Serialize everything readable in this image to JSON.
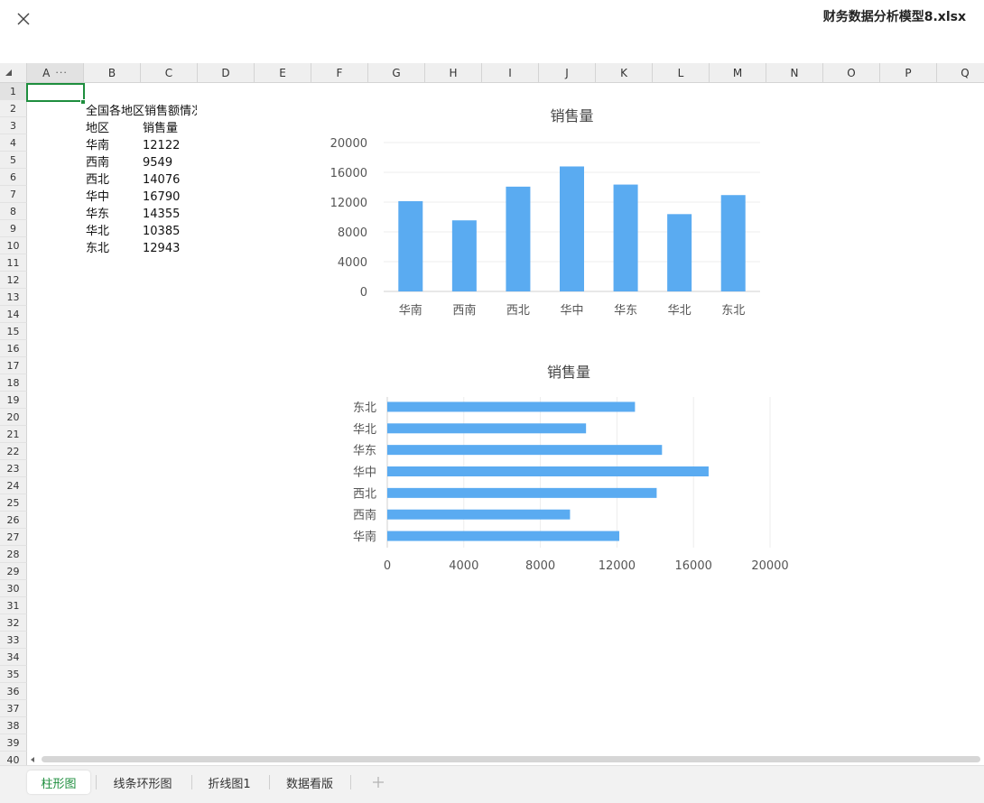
{
  "window": {
    "file_title": "财务数据分析模型8.xlsx"
  },
  "grid": {
    "columns": [
      "A",
      "B",
      "C",
      "D",
      "E",
      "F",
      "G",
      "H",
      "I",
      "J",
      "K",
      "L",
      "M",
      "N",
      "O",
      "P",
      "Q"
    ],
    "rows": [
      "1",
      "2",
      "3",
      "4",
      "5",
      "6",
      "7",
      "8",
      "9",
      "10",
      "11",
      "12",
      "13",
      "14",
      "15",
      "16",
      "17",
      "18",
      "19",
      "20",
      "21",
      "22",
      "23",
      "24",
      "25",
      "26",
      "27",
      "28",
      "29",
      "30",
      "31",
      "32",
      "33",
      "34",
      "35",
      "36",
      "37",
      "38",
      "39",
      "40"
    ],
    "column_more_glyph": "···",
    "table_title": "全国各地区销售额情况",
    "headers": [
      "地区",
      "销售量"
    ],
    "table_rows": [
      [
        "华南",
        "12122"
      ],
      [
        "西南",
        "9549"
      ],
      [
        "西北",
        "14076"
      ],
      [
        "华中",
        "16790"
      ],
      [
        "华东",
        "14355"
      ],
      [
        "华北",
        "10385"
      ],
      [
        "东北",
        "12943"
      ]
    ]
  },
  "chart_data": [
    {
      "type": "bar",
      "orientation": "vertical",
      "title": "销售量",
      "categories": [
        "华南",
        "西南",
        "西北",
        "华中",
        "华东",
        "华北",
        "东北"
      ],
      "values": [
        12122,
        9549,
        14076,
        16790,
        14355,
        10385,
        12943
      ],
      "ylim": [
        0,
        20000
      ],
      "ticks": [
        "0",
        "4000",
        "8000",
        "12000",
        "16000",
        "20000"
      ],
      "grid": true,
      "color": "#5aabf1"
    },
    {
      "type": "bar",
      "orientation": "horizontal",
      "title": "销售量",
      "categories": [
        "华南",
        "西南",
        "西北",
        "华中",
        "华东",
        "华北",
        "东北"
      ],
      "values": [
        12122,
        9549,
        14076,
        16790,
        14355,
        10385,
        12943
      ],
      "xlim": [
        0,
        20000
      ],
      "ticks": [
        "0",
        "4000",
        "8000",
        "12000",
        "16000",
        "20000"
      ],
      "grid": true,
      "color": "#5aabf1"
    }
  ],
  "sheet_tabs": {
    "items": [
      "柱形图",
      "线条环形图",
      "折线图1",
      "数据看版"
    ],
    "active_index": 0
  },
  "icons": {
    "close": "close-icon",
    "add_sheet": "plus-icon",
    "select_all": "select-all-triangle-icon"
  },
  "colors": {
    "accent": "#1e8e3e",
    "bar": "#5aabf1"
  }
}
